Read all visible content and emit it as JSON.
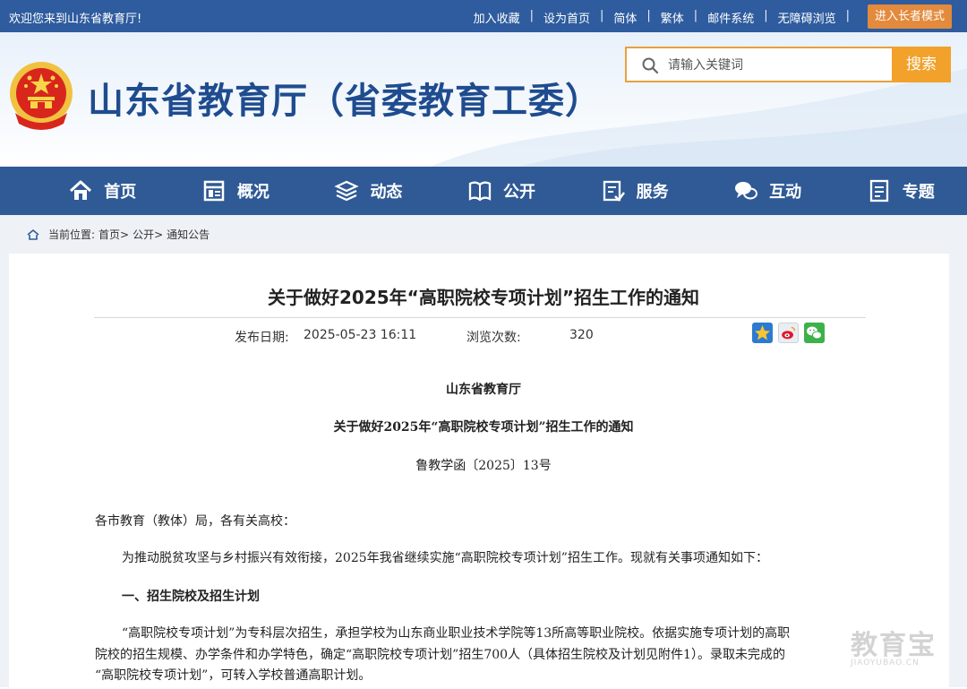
{
  "topbar": {
    "welcome": "欢迎您来到山东省教育厅!",
    "links": [
      "加入收藏",
      "设为首页",
      "简体",
      "繁体",
      "邮件系统",
      "无障碍浏览"
    ],
    "elder_mode": "进入长者模式"
  },
  "header": {
    "title": "山东省教育厅（省委教育工委）",
    "search_placeholder": "请输入关键词",
    "search_button": "搜索"
  },
  "nav": {
    "items": [
      {
        "label": "首页",
        "icon": "home-icon"
      },
      {
        "label": "概况",
        "icon": "overview-icon"
      },
      {
        "label": "动态",
        "icon": "news-icon"
      },
      {
        "label": "公开",
        "icon": "book-icon"
      },
      {
        "label": "服务",
        "icon": "service-icon"
      },
      {
        "label": "互动",
        "icon": "chat-icon"
      },
      {
        "label": "专题",
        "icon": "topic-icon"
      }
    ]
  },
  "breadcrumb": {
    "prefix": "当前位置:",
    "items": [
      "首页>",
      "公开>",
      "通知公告"
    ]
  },
  "article": {
    "title": "关于做好2025年“高职院校专项计划”招生工作的通知",
    "date_label": "发布日期:",
    "date": "2025-05-23 16:11",
    "views_label": "浏览次数:",
    "views": "320",
    "issuer": "山东省教育厅",
    "doc_title": "关于做好2025年“高职院校专项计划”招生工作的通知",
    "doc_number": "鲁教学函〔2025〕13号",
    "salutation": "各市教育（教体）局，各有关高校：",
    "para1": "为推动脱贫攻坚与乡村振兴有效衔接，2025年我省继续实施“高职院校专项计划”招生工作。现就有关事项通知如下：",
    "section1": "一、招生院校及招生计划",
    "para2_line1": "“高职院校专项计划”为专科层次招生，承担学校为山东商业职业技术学院等13所高等职业院校。依据实施专项计划的高职",
    "para2_line2": "院校的招生规模、办学条件和办学特色，确定“高职院校专项计划”招生700人（具体招生院校及计划见附件1）。录取未完成的",
    "para2_line3": "“高职院校专项计划”，可转入学校普通高职计划。"
  },
  "share_icons": [
    "qzone-icon",
    "weibo-icon",
    "wechat-icon"
  ],
  "watermark": {
    "big": "教育宝",
    "small": "JIAOYUBAO.CN"
  },
  "colors": {
    "topbar": "#2e5c9e",
    "nav": "#2f5a95",
    "accent": "#f2a12a",
    "title": "#1f4c8f"
  }
}
